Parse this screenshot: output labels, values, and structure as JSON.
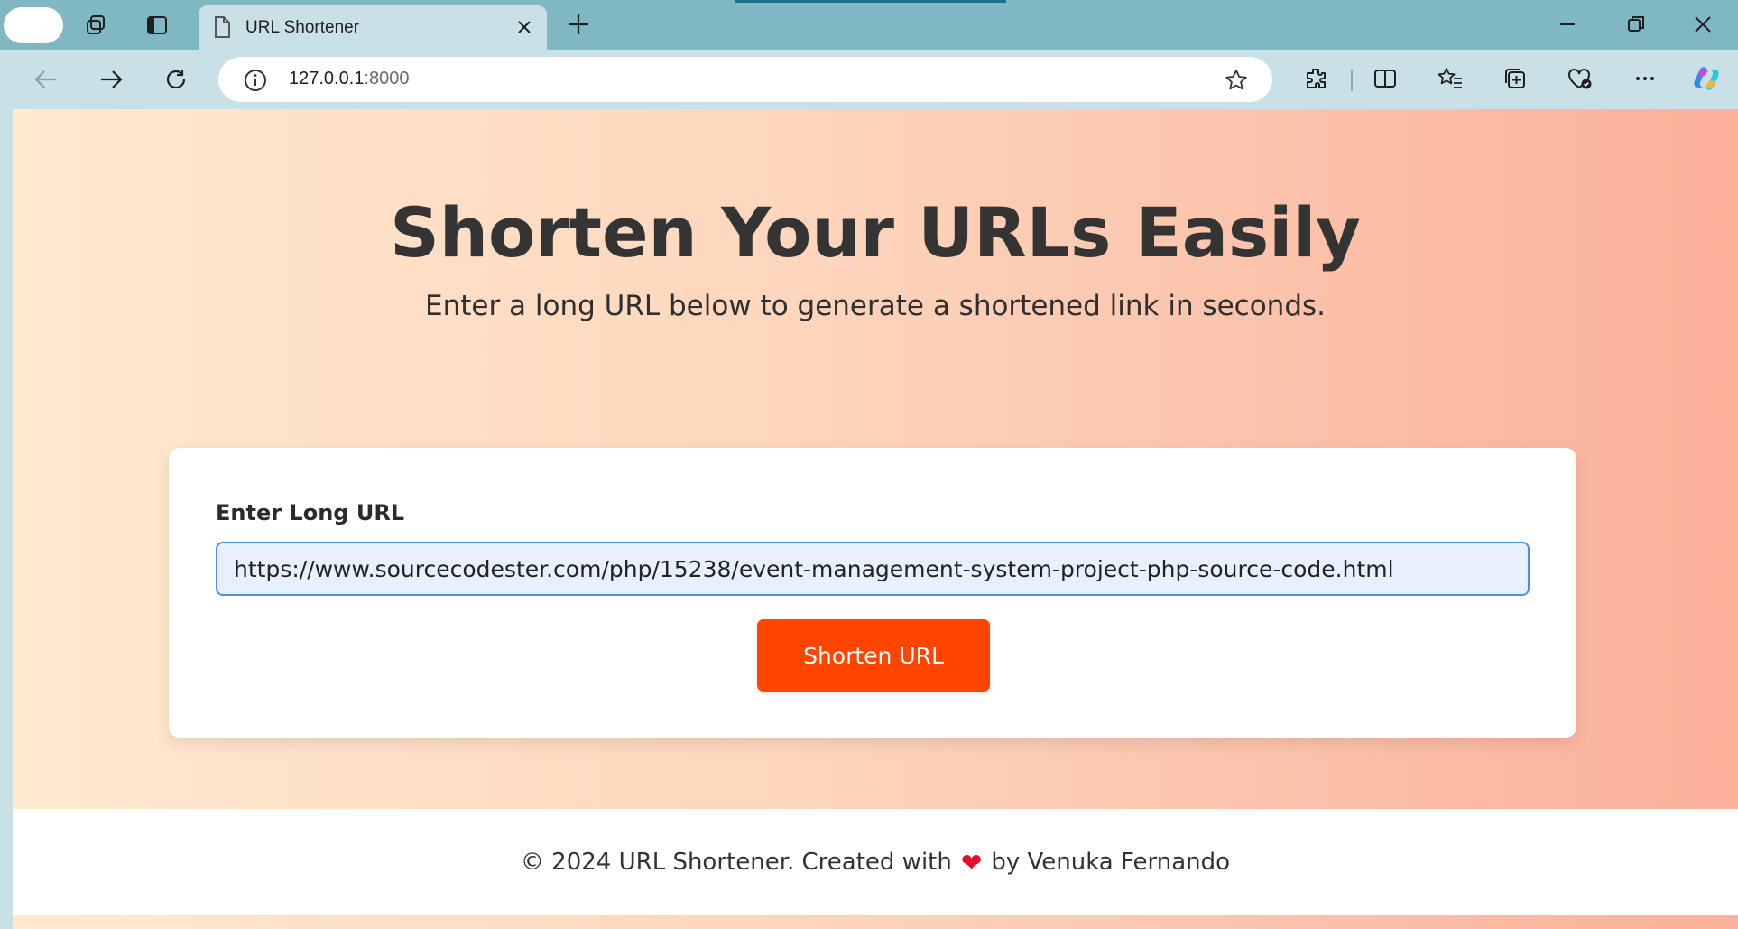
{
  "browser": {
    "tab": {
      "title": "URL Shortener"
    },
    "address": {
      "host": "127.0.0.1",
      "port": ":8000"
    }
  },
  "page": {
    "hero": {
      "title": "Shorten Your URLs Easily",
      "subtitle": "Enter a long URL below to generate a shortened link in seconds."
    },
    "form": {
      "label": "Enter Long URL",
      "input_value": "https://www.sourcecodester.com/php/15238/event-management-system-project-php-source-code.html",
      "button_label": "Shorten URL"
    },
    "footer": {
      "prefix": "© 2024 URL Shortener. Created with",
      "heart": "❤",
      "suffix": "by Venuka Fernando"
    }
  },
  "colors": {
    "accent": "#ff4500",
    "title_bar": "#7fb8c3",
    "toolbar": "#c9e1e6",
    "input_border": "#4a8fe0"
  },
  "icons": [
    "workspaces-icon",
    "tab-actions-icon",
    "page-icon",
    "close-icon",
    "plus-icon",
    "minimize-icon",
    "restore-icon",
    "back-icon",
    "forward-icon",
    "refresh-icon",
    "info-icon",
    "star-icon",
    "extensions-icon",
    "split-screen-icon",
    "favorites-icon",
    "collections-icon",
    "browser-essentials-icon",
    "more-icon",
    "copilot-icon"
  ]
}
